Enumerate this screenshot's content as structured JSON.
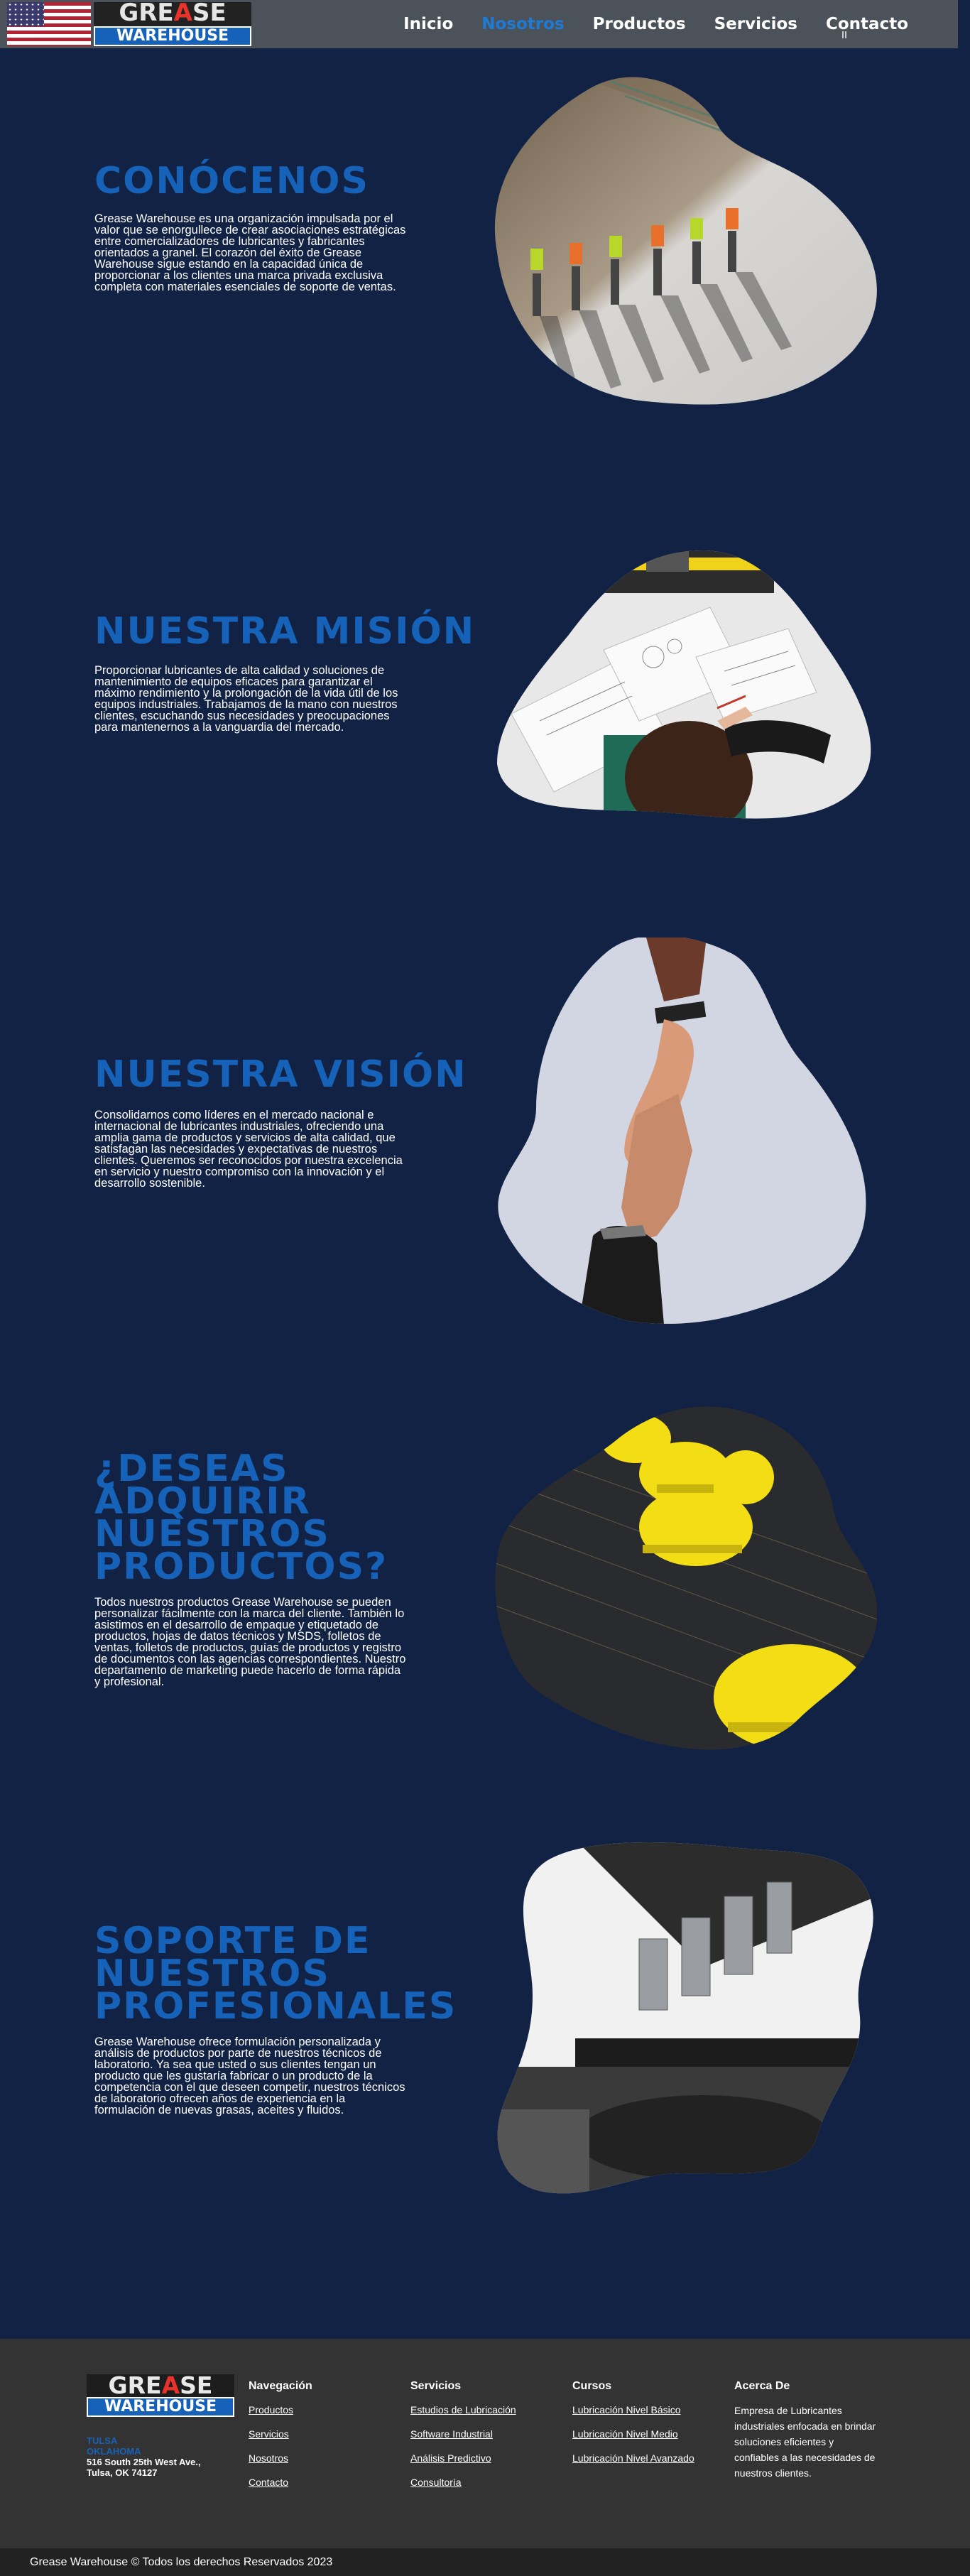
{
  "header": {
    "brand_top_1": "GRE",
    "brand_top_drop": "A",
    "brand_top_2": "SE",
    "brand_bottom": "WAREHOUSE",
    "nav": [
      {
        "label": "Inicio"
      },
      {
        "label": "Nosotros"
      },
      {
        "label": "Productos"
      },
      {
        "label": "Servicios"
      },
      {
        "label": "Contacto"
      }
    ],
    "accent_color": "#1e7bd4"
  },
  "sections": [
    {
      "title": "CONÓCENOS",
      "text": "Grease Warehouse es una organización impulsada por el valor que se enorgullece de crear asociaciones estratégicas entre comercializadores de lubricantes y fabricantes orientados a granel. El corazón del éxito de Grease Warehouse sigue estando en la capacidad única de proporcionar a los clientes una marca privada exclusiva completa con materiales esenciales de soporte de ventas.",
      "image": "workers-site-photo"
    },
    {
      "title": "NUESTRA MISIÓN",
      "text": "Proporcionar lubricantes de alta calidad y soluciones de mantenimiento de equipos eficaces para garantizar el máximo rendimiento y la prolongación de la vida útil de los equipos industriales. Trabajamos de la mano con nuestros clientes, escuchando sus necesidades y preocupaciones para mantenernos a la vanguardia del mercado.",
      "image": "blueprint-desk-photo"
    },
    {
      "title": "NUESTRA VISIÓN",
      "text": "Consolidarnos como líderes en el mercado nacional e internacional de lubricantes industriales, ofreciendo una amplia gama de productos y servicios de alta calidad, que satisfagan las necesidades y expectativas de nuestros clientes. Queremos ser reconocidos por nuestra excelencia en servicio y nuestro compromiso con la innovación y el desarrollo sostenible.",
      "image": "helping-hands-photo"
    },
    {
      "title": "¿DESEAS ADQUIRIR NUESTROS PRODUCTOS?",
      "text": "Todos nuestros productos Grease Warehouse se pueden personalizar fácilmente con la marca del cliente. También lo asistimos en el desarrollo de empaque y etiquetado de productos, hojas de datos técnicos y MSDS, folletos de ventas, folletos de productos, guías de productos y registro de documentos con las agencias correspondientes. Nuestro departamento de marketing puede hacerlo de forma rápida y profesional.",
      "image": "hard-hats-photo"
    },
    {
      "title": "SOPORTE DE NUESTROS PROFESIONALES",
      "text": "Grease Warehouse ofrece formulación personalizada y análisis de productos por parte de nuestros técnicos de laboratorio. Ya sea que usted o sus clientes tengan un producto que les gustaría fabricar o un producto de la competencia con el que deseen competir, nuestros técnicos de laboratorio ofrecen años de experiencia en la formulación de nuevas grasas, aceites y fluidos.",
      "image": "microscope-photo"
    }
  ],
  "footer": {
    "logo_top_1": "GRE",
    "logo_top_drop": "A",
    "logo_top_2": "SE",
    "logo_bottom": "WAREHOUSE",
    "city_line1": "TULSA",
    "city_line2": "OKLAHOMA",
    "street_line1": "516 South 25th West Ave.,",
    "street_line2": "Tulsa, OK 74127",
    "columns": [
      {
        "title": "Navegación",
        "links": [
          "Productos",
          "Servicios",
          "Nosotros",
          "Contacto"
        ]
      },
      {
        "title": "Servicios",
        "links": [
          "Estudios de Lubricación",
          "Software Industrial",
          "Análisis Predictivo",
          "Consultoría"
        ]
      },
      {
        "title": "Cursos",
        "links": [
          "Lubricación Nivel Básico",
          "Lubricación Nivel Medio",
          "Lubricación Nivel Avanzado"
        ]
      }
    ],
    "about_title": "Acerca De",
    "about_text": "Empresa de Lubricantes industriales enfocada en brindar soluciones eficientes y confiables a las necesidades de nuestros clientes.",
    "copyright": "Grease Warehouse © Todos los derechos Reservados 2023"
  }
}
